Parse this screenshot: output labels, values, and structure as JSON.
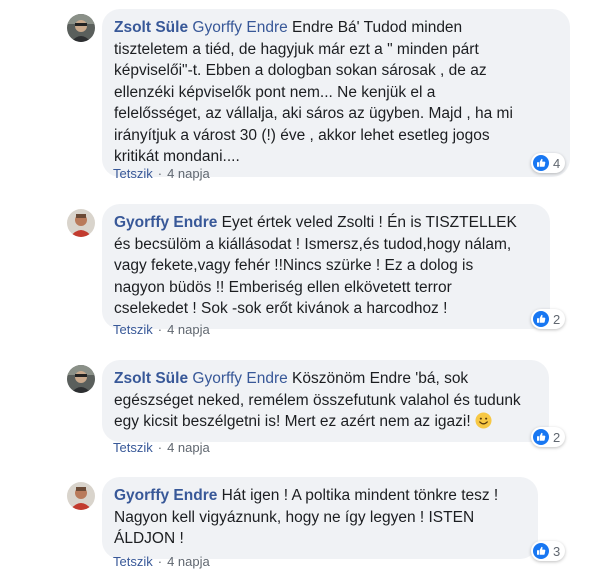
{
  "comments": [
    {
      "author": "Zsolt Süle",
      "tag": "Gyorffy Endre",
      "lines": [
        "Endre Bá' Tudod minden",
        "tiszteletem a tiéd, de hagyjuk már ezt a \" minden párt",
        "képviselői\"-t. Ebben a dologban sokan sárosak , de az",
        "ellenzéki képviselők pont nem... Ne kenjük el a",
        "felelősséget, az vállalja, aki sáros az ügyben. Majd , ha mi",
        "irányítjuk a várost 30 (!) éve , akkor lehet esetleg jogos",
        "kritikát mondani...."
      ],
      "reactions": "4",
      "like_label": "Tetszik",
      "time": "4 napja"
    },
    {
      "author": "Gyorffy Endre",
      "tag": "",
      "lines": [
        "Eyet értek veled Zsolti ! Én is TISZTELLEK",
        "és becsülöm a kiállásodat ! Ismersz,és tudod,hogy nálam,",
        "vagy fekete,vagy fehér !!Nincs szürke ! Ez a dolog is",
        "nagyon büdös !! Emberiség ellen elkövetett terror",
        "cselekedet ! Sok -sok erőt kivánok a harcodhoz !"
      ],
      "reactions": "2",
      "like_label": "Tetszik",
      "time": "4 napja"
    },
    {
      "author": "Zsolt Süle",
      "tag": "Gyorffy Endre",
      "lines": [
        "Köszönöm Endre 'bá, sok",
        "egészséget neked, remélem összefutunk valahol és tudunk",
        "egy kicsit beszélgetni is! Mert ez azért nem az igazi!"
      ],
      "reactions": "2",
      "like_label": "Tetszik",
      "time": "4 napja"
    },
    {
      "author": "Gyorffy Endre",
      "tag": "",
      "lines": [
        "Hát igen ! A poltika mindent tönkre tesz !",
        "Nagyon kell vigyáznunk, hogy ne így legyen ! ISTEN",
        "ÁLDJON !"
      ],
      "reactions": "3",
      "like_label": "Tetszik",
      "time": "4 napja"
    }
  ],
  "colors": {
    "bubble": "#f0f2f5",
    "link": "#385898",
    "like_blue": "#1877f2",
    "meta": "#606770"
  },
  "icons": {
    "reaction": "like-thumb-icon",
    "emoji": "smiley-emoji-icon"
  }
}
